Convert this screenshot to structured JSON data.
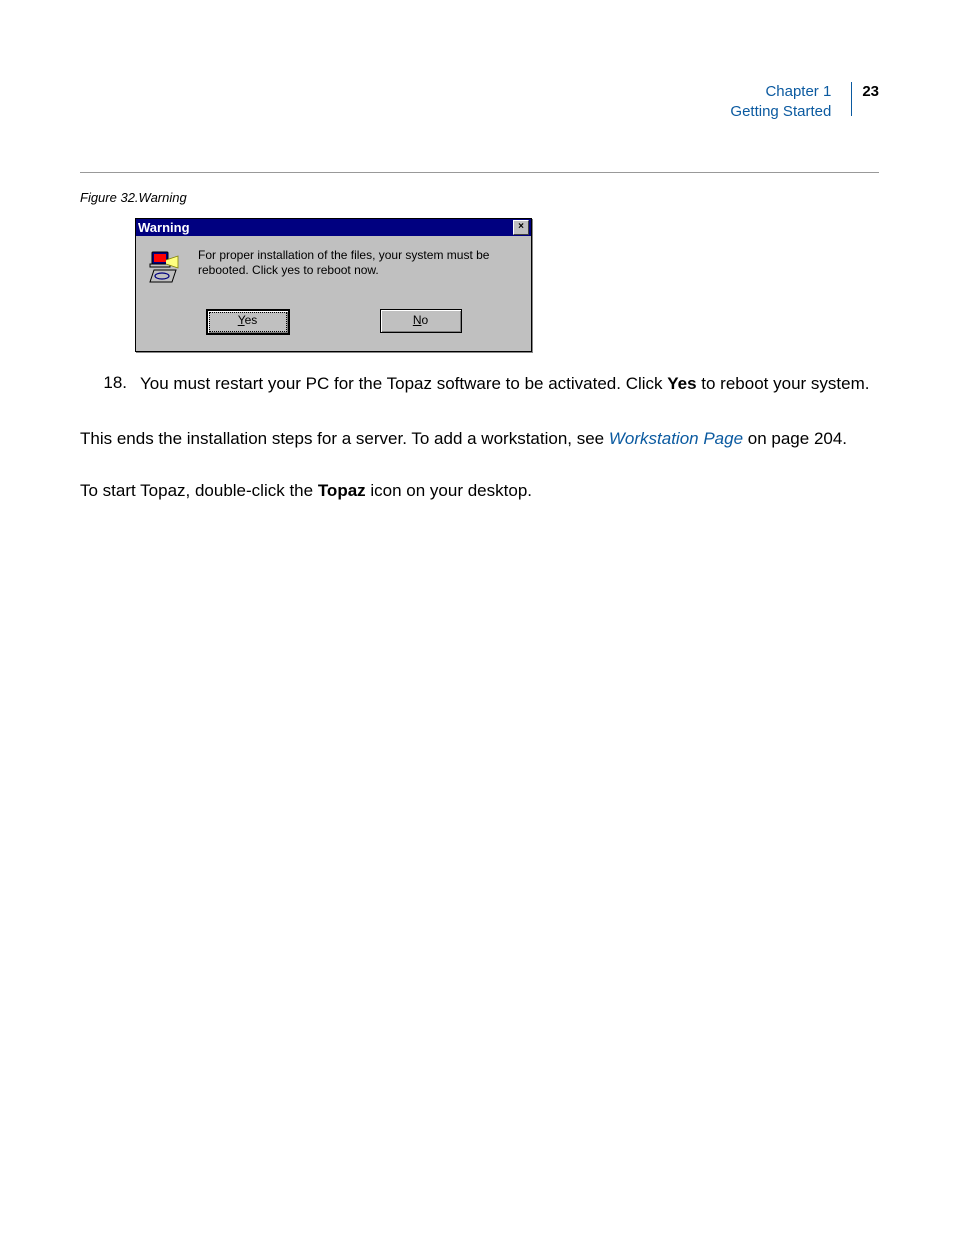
{
  "header": {
    "chapter": "Chapter 1",
    "section": "Getting Started",
    "page_number": "23"
  },
  "figure_caption": "Figure 32.Warning",
  "dialog": {
    "title": "Warning",
    "message": "For proper installation of the files, your system must be rebooted. Click yes to reboot now.",
    "yes_prefix": "Y",
    "yes_suffix": "es",
    "no_prefix": "N",
    "no_suffix": "o",
    "close_glyph": "×"
  },
  "step18": {
    "number": "18.",
    "text_before_yes": "You must restart your PC for the Topaz software to be activated. Click ",
    "yes_word": "Yes",
    "text_after_yes": " to reboot your system."
  },
  "para2": {
    "before_link": "This ends the installation steps for a server. To add a workstation, see ",
    "link_text": "Workstation Page",
    "after_link": " on page 204."
  },
  "para3": {
    "before_bold": "To start Topaz, double-click the ",
    "bold_word": "Topaz",
    "after_bold": " icon on your desktop."
  }
}
